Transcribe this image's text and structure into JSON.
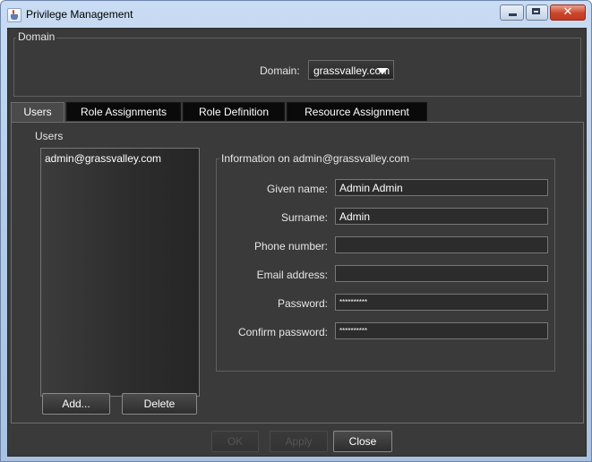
{
  "window": {
    "title": "Privilege Management",
    "icon": "java-cup-icon",
    "controls": {
      "minimize": "minimize-icon",
      "maximize": "maximize-icon",
      "close": "close-icon"
    }
  },
  "domain": {
    "group_title": "Domain",
    "label": "Domain:",
    "selected": "grassvalley.com"
  },
  "tabs": [
    {
      "label": "Users",
      "active": true
    },
    {
      "label": "Role Assignments",
      "active": false
    },
    {
      "label": "Role Definition",
      "active": false
    },
    {
      "label": "Resource Assignment",
      "active": false
    }
  ],
  "users": {
    "heading": "Users",
    "list": [
      "admin@grassvalley.com"
    ],
    "add_label": "Add...",
    "delete_label": "Delete"
  },
  "info": {
    "title": "Information on admin@grassvalley.com",
    "fields": [
      {
        "label": "Given name:",
        "value": "Admin Admin"
      },
      {
        "label": "Surname:",
        "value": "Admin"
      },
      {
        "label": "Phone number:",
        "value": ""
      },
      {
        "label": "Email address:",
        "value": ""
      },
      {
        "label": "Password:",
        "value": "**********"
      },
      {
        "label": "Confirm password:",
        "value": "**********"
      }
    ]
  },
  "footer": {
    "ok_label": "OK",
    "apply_label": "Apply",
    "close_label": "Close"
  },
  "colors": {
    "client_bg": "#3a3a3a",
    "tab_active": "#4a4a4a",
    "tab_inactive": "#0a0a0a",
    "text": "#e6e6e6"
  }
}
